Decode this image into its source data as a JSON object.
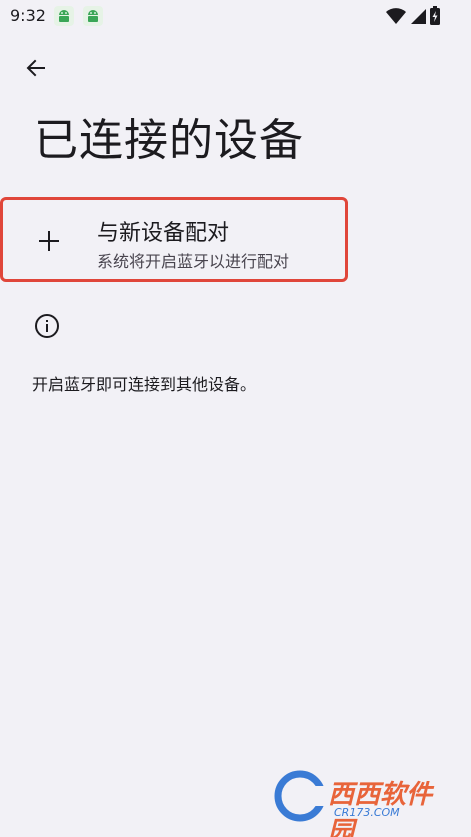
{
  "status_bar": {
    "time": "9:32",
    "notification_icons": [
      "android-notification-icon",
      "android-notification-icon"
    ],
    "indicators": [
      "wifi-icon",
      "cellular-signal-icon",
      "battery-charging-icon"
    ]
  },
  "app_bar": {
    "back_icon": "arrow-left-icon",
    "title": "已连接的设备"
  },
  "pair_device": {
    "icon": "plus-icon",
    "title": "与新设备配对",
    "subtitle": "系统将开启蓝牙以进行配对"
  },
  "info": {
    "icon": "info-icon",
    "text": "开启蓝牙即可连接到其他设备。"
  },
  "watermark": {
    "text": "西西软件园",
    "sub": "CR173.COM"
  },
  "colors": {
    "background": "#f2f1f6",
    "highlight_border": "#e0463a",
    "primary_text": "#1c1b1f",
    "secondary_text": "#49454f"
  }
}
